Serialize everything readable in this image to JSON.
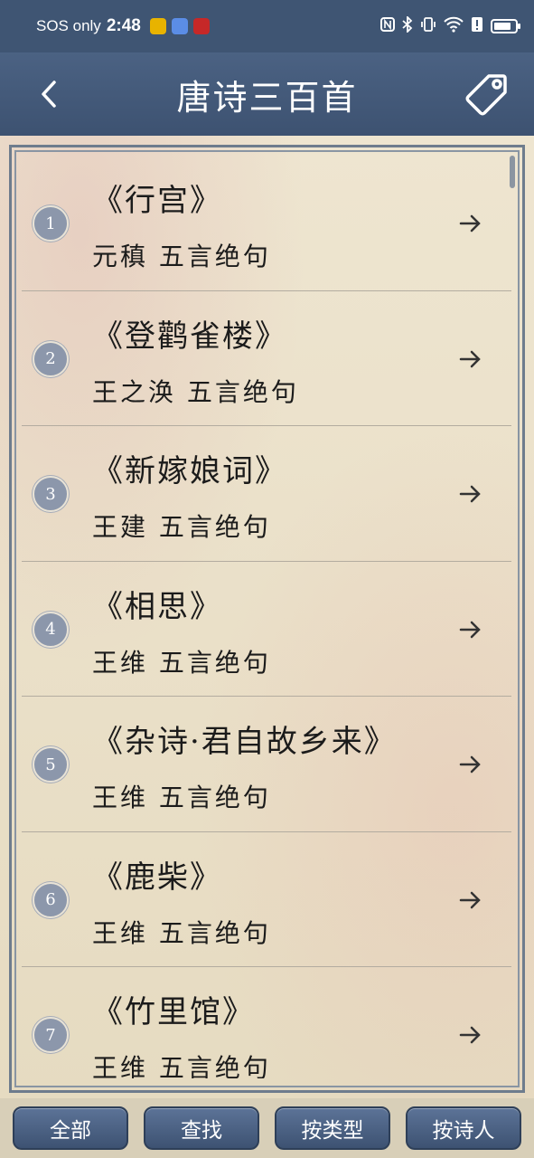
{
  "status": {
    "carrier": "SOS only",
    "time": "2:48",
    "battery_level": 0.7
  },
  "header": {
    "title": "唐诗三百首",
    "back_icon": "chevron-left-icon",
    "tag_icon": "tag-icon"
  },
  "poems": [
    {
      "num": "1",
      "title": "《行宫》",
      "subtitle": "元稹  五言绝句"
    },
    {
      "num": "2",
      "title": "《登鹳雀楼》",
      "subtitle": "王之涣  五言绝句"
    },
    {
      "num": "3",
      "title": "《新嫁娘词》",
      "subtitle": "王建  五言绝句"
    },
    {
      "num": "4",
      "title": "《相思》",
      "subtitle": "王维  五言绝句"
    },
    {
      "num": "5",
      "title": "《杂诗·君自故乡来》",
      "subtitle": "王维  五言绝句"
    },
    {
      "num": "6",
      "title": "《鹿柴》",
      "subtitle": "王维  五言绝句"
    },
    {
      "num": "7",
      "title": "《竹里馆》",
      "subtitle": "王维  五言绝句"
    }
  ],
  "bottom": {
    "all": "全部",
    "search": "查找",
    "by_type": "按类型",
    "by_poet": "按诗人"
  },
  "colors": {
    "header": "#3f5573",
    "badge": "#8c97ab",
    "button": "#4a6182"
  }
}
